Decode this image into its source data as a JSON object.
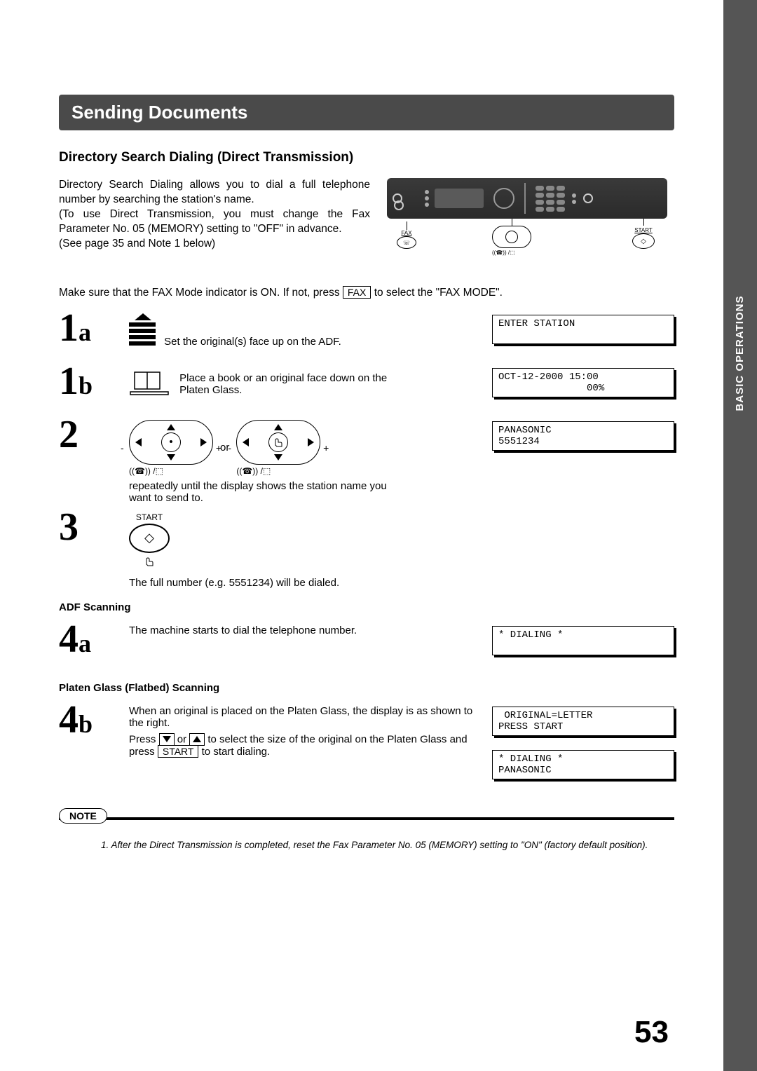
{
  "title": "Sending Documents",
  "subhead": "Directory Search Dialing (Direct Transmission)",
  "intro": {
    "p1": "Directory Search Dialing allows you to dial a full telephone number by searching the station's name.",
    "p2": "(To use Direct Transmission, you must change the Fax Parameter No. 05 (MEMORY) setting to \"OFF\" in advance.",
    "p3": "(See page 35 and Note 1 below)"
  },
  "device_labels": {
    "fax": "FAX",
    "fax_icon": "☏",
    "start": "START",
    "start_symbol": "◇"
  },
  "mode_line": {
    "pre": "Make sure that the FAX Mode indicator is ON.  If not, press ",
    "key": "FAX",
    "post": " to select the \"FAX MODE\"."
  },
  "steps": {
    "s1a": {
      "num": "1",
      "letter": "a",
      "text": "Set the original(s) face up on the ADF."
    },
    "s1b": {
      "num": "1",
      "letter": "b",
      "text": "Place a book or an original face down on the Platen Glass."
    },
    "s2": {
      "num": "2",
      "or": "or",
      "text": "repeatedly until the display shows the station name you want to send to."
    },
    "s3": {
      "num": "3",
      "start": "START",
      "text": "The full number (e.g. 5551234) will be dialed."
    },
    "adf_head": "ADF Scanning",
    "s4a": {
      "num": "4",
      "letter": "a",
      "text": "The machine starts to dial the telephone number."
    },
    "platen_head": "Platen Glass (Flatbed) Scanning",
    "s4b": {
      "num": "4",
      "letter": "b",
      "l1": "When an original is placed on the Platen Glass, the display is as shown to the right.",
      "l2_pre": "Press ",
      "l2_mid": " or ",
      "l2_post": " to select the size of the original on the Platen Glass and press ",
      "l2_key": "START",
      "l2_end": " to start dialing."
    }
  },
  "lcd": {
    "d1": "ENTER STATION\n ",
    "d1b": "OCT-12-2000 15:00\n               00%",
    "d2": "PANASONIC\n5551234",
    "d4a": "* DIALING *\n ",
    "d4b1": " ORIGINAL=LETTER\nPRESS START",
    "d4b2": "* DIALING *\nPANASONIC"
  },
  "dial_sub_icons": "((☎)) /⬚",
  "note": {
    "label": "NOTE",
    "text": "1. After the Direct Transmission is completed, reset the Fax Parameter No. 05 (MEMORY) setting to \"ON\" (factory default position)."
  },
  "side_label": "BASIC\nOPERATIONS",
  "page_number": "53"
}
